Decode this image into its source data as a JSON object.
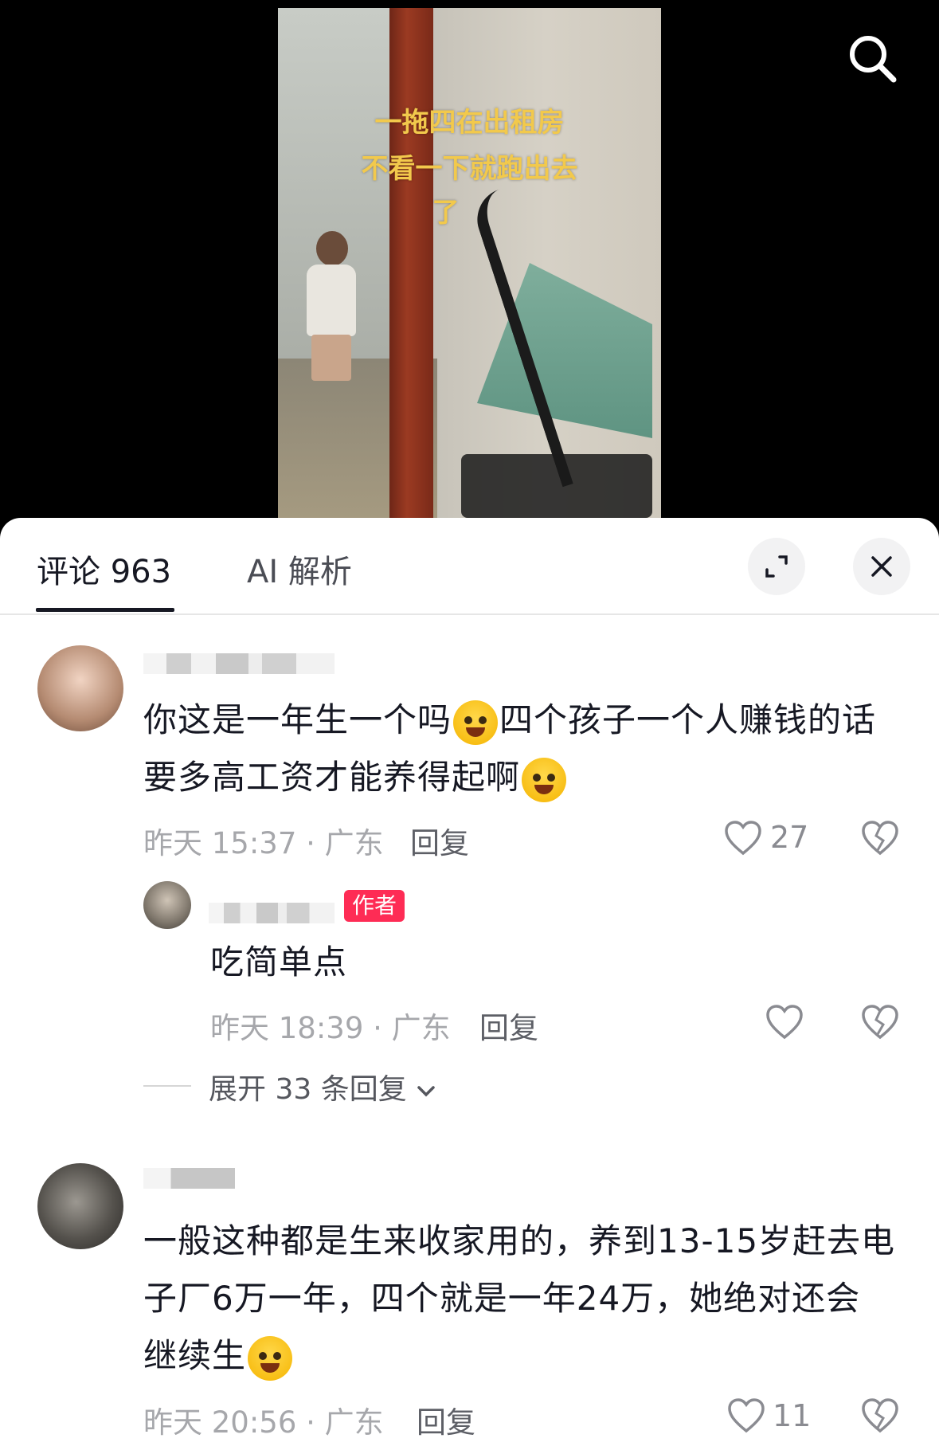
{
  "video": {
    "caption_lines": [
      "一拖四在出租房",
      "不看一下就跑出去",
      "了"
    ]
  },
  "top_icons": {
    "search": "search-icon"
  },
  "tabs": [
    {
      "label": "评论 963",
      "active": true
    },
    {
      "label": "AI 解析",
      "active": false
    }
  ],
  "header_buttons": {
    "expand": "expand-icon",
    "close": "close-icon"
  },
  "comments": [
    {
      "text_line1": "你这是一年生一个吗",
      "text_line1b": "四个孩子一个人赚钱的话",
      "text_line2": "要多高工资才能养得起啊",
      "emoji": "loudly-crying-emoji",
      "time": "昨天 15:37 · 广东",
      "reply_label": "回复",
      "likes": "27",
      "replies": [
        {
          "badge": "作者",
          "text": "吃简单点",
          "time": "昨天 18:39 · 广东",
          "reply_label": "回复"
        }
      ],
      "expand_label": "展开 33 条回复"
    },
    {
      "text_line1": "一般这种都是生来收家用的，养到13-15岁赶去电",
      "text_line2": "子厂6万一年，四个就是一年24万，她绝对还会",
      "text_line3": "继续生",
      "emoji": "rolling-laughing-emoji",
      "time": "昨天 20:56 · 广东",
      "reply_label": "回复",
      "likes": "11"
    }
  ],
  "colors": {
    "accent": "#fe2c55",
    "text": "#161823",
    "meta": "#a6a7ab",
    "caption": "#f2c94c"
  }
}
